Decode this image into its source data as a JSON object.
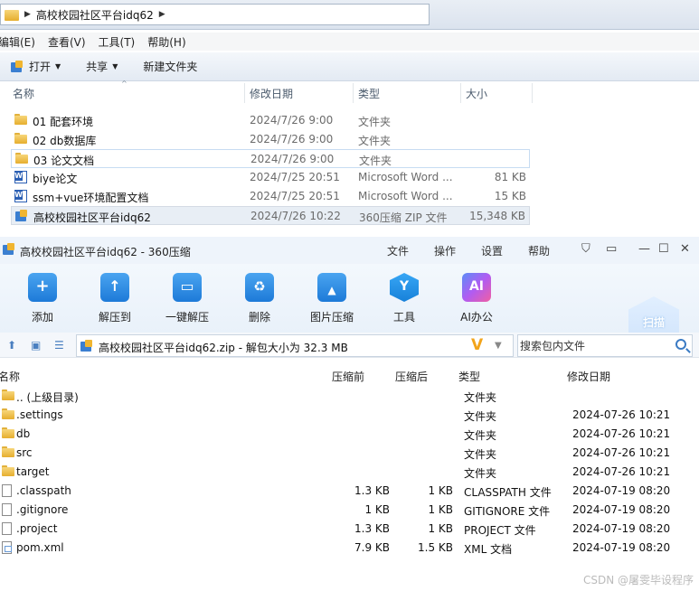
{
  "explorer": {
    "breadcrumb": "高校校园社区平台idq62",
    "menu": [
      "编辑(E)",
      "查看(V)",
      "工具(T)",
      "帮助(H)"
    ],
    "toolbar": {
      "open": "打开",
      "share": "共享",
      "new_folder": "新建文件夹"
    },
    "columns": {
      "name": "名称",
      "date": "修改日期",
      "type": "类型",
      "size": "大小"
    },
    "files": [
      {
        "name": "01 配套环境",
        "date": "2024/7/26 9:00",
        "type": "文件夹",
        "size": "",
        "icon": "folder-icon"
      },
      {
        "name": "02 db数据库",
        "date": "2024/7/26 9:00",
        "type": "文件夹",
        "size": "",
        "icon": "folder-icon"
      },
      {
        "name": "03 论文文档",
        "date": "2024/7/26 9:00",
        "type": "文件夹",
        "size": "",
        "icon": "folder-icon"
      },
      {
        "name": "biye论文",
        "date": "2024/7/25 20:51",
        "type": "Microsoft Word ...",
        "size": "81 KB",
        "icon": "word-icon"
      },
      {
        "name": "ssm+vue环境配置文档",
        "date": "2024/7/25 20:51",
        "type": "Microsoft Word ...",
        "size": "15 KB",
        "icon": "word-icon"
      },
      {
        "name": "高校校园社区平台idq62",
        "date": "2024/7/26 10:22",
        "type": "360压缩 ZIP 文件",
        "size": "15,348 KB",
        "icon": "zip-icon"
      }
    ]
  },
  "zipwin": {
    "title": "高校校园社区平台idq62 - 360压缩",
    "menu": [
      "文件",
      "操作",
      "设置",
      "帮助"
    ],
    "ribbon": [
      "添加",
      "解压到",
      "一键解压",
      "删除",
      "图片压缩",
      "工具",
      "AI办公"
    ],
    "scan": "扫描",
    "path": "高校校园社区平台idq62.zip - 解包大小为 32.3 MB",
    "search_placeholder": "搜索包内文件",
    "columns": {
      "name": "名称",
      "size_before": "压缩前",
      "size_after": "压缩后",
      "type": "类型",
      "date": "修改日期"
    },
    "rows": [
      {
        "name": ".. (上级目录)",
        "size_before": "",
        "size_after": "",
        "type": "文件夹",
        "date": "",
        "icon": "folder-icon"
      },
      {
        "name": ".settings",
        "size_before": "",
        "size_after": "",
        "type": "文件夹",
        "date": "2024-07-26 10:21",
        "icon": "folder-icon"
      },
      {
        "name": "db",
        "size_before": "",
        "size_after": "",
        "type": "文件夹",
        "date": "2024-07-26 10:21",
        "icon": "folder-icon"
      },
      {
        "name": "src",
        "size_before": "",
        "size_after": "",
        "type": "文件夹",
        "date": "2024-07-26 10:21",
        "icon": "folder-icon"
      },
      {
        "name": "target",
        "size_before": "",
        "size_after": "",
        "type": "文件夹",
        "date": "2024-07-26 10:21",
        "icon": "folder-icon"
      },
      {
        "name": ".classpath",
        "size_before": "1.3 KB",
        "size_after": "1 KB",
        "type": "CLASSPATH 文件",
        "date": "2024-07-19 08:20",
        "icon": "file-icon"
      },
      {
        "name": ".gitignore",
        "size_before": "1 KB",
        "size_after": "1 KB",
        "type": "GITIGNORE 文件",
        "date": "2024-07-19 08:20",
        "icon": "file-icon"
      },
      {
        "name": ".project",
        "size_before": "1.3 KB",
        "size_after": "1 KB",
        "type": "PROJECT 文件",
        "date": "2024-07-19 08:20",
        "icon": "file-icon"
      },
      {
        "name": "pom.xml",
        "size_before": "7.9 KB",
        "size_after": "1.5 KB",
        "type": "XML 文档",
        "date": "2024-07-19 08:20",
        "icon": "xml-file-icon"
      }
    ]
  },
  "watermark": "CSDN @屠雯毕设程序"
}
